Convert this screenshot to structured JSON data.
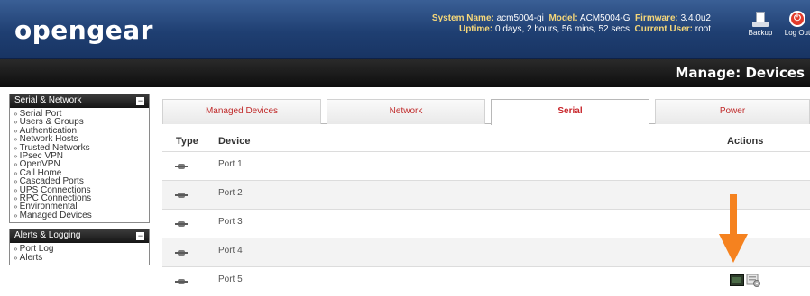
{
  "header": {
    "logo": "opengear",
    "system_name_label": "System Name:",
    "system_name_value": "acm5004-gi",
    "model_label": "Model:",
    "model_value": "ACM5004-G",
    "firmware_label": "Firmware:",
    "firmware_value": "3.4.0u2",
    "uptime_label": "Uptime:",
    "uptime_value": "0 days, 2 hours, 56 mins, 52 secs",
    "current_user_label": "Current User:",
    "current_user_value": "root",
    "backup_label": "Backup",
    "logout_label": "Log Out"
  },
  "page_title": "Manage: Devices",
  "sidebar": {
    "serial_network": {
      "title": "Serial & Network",
      "items": [
        "Serial Port",
        "Users & Groups",
        "Authentication",
        "Network Hosts",
        "Trusted Networks",
        "IPsec VPN",
        "OpenVPN",
        "Call Home",
        "Cascaded Ports",
        "UPS Connections",
        "RPC Connections",
        "Environmental",
        "Managed Devices"
      ]
    },
    "alerts_logging": {
      "title": "Alerts & Logging",
      "items": [
        "Port Log",
        "Alerts"
      ]
    }
  },
  "tabs": [
    {
      "label": "Managed Devices",
      "active": false
    },
    {
      "label": "Network",
      "active": false
    },
    {
      "label": "Serial",
      "active": true
    },
    {
      "label": "Power",
      "active": false
    }
  ],
  "table": {
    "headers": {
      "type": "Type",
      "device": "Device",
      "actions": "Actions"
    },
    "rows": [
      {
        "device": "Port 1"
      },
      {
        "device": "Port 2"
      },
      {
        "device": "Port 3"
      },
      {
        "device": "Port 4"
      },
      {
        "device": "Port 5"
      }
    ]
  },
  "colors": {
    "header_blue": "#1f3f72",
    "tab_text": "#c02a2a",
    "arrow": "#f5821f"
  },
  "icons": {
    "port": "serial-port-icon",
    "console": "console-icon",
    "config": "config-icon",
    "backup": "backup-icon",
    "logout": "power-icon"
  }
}
